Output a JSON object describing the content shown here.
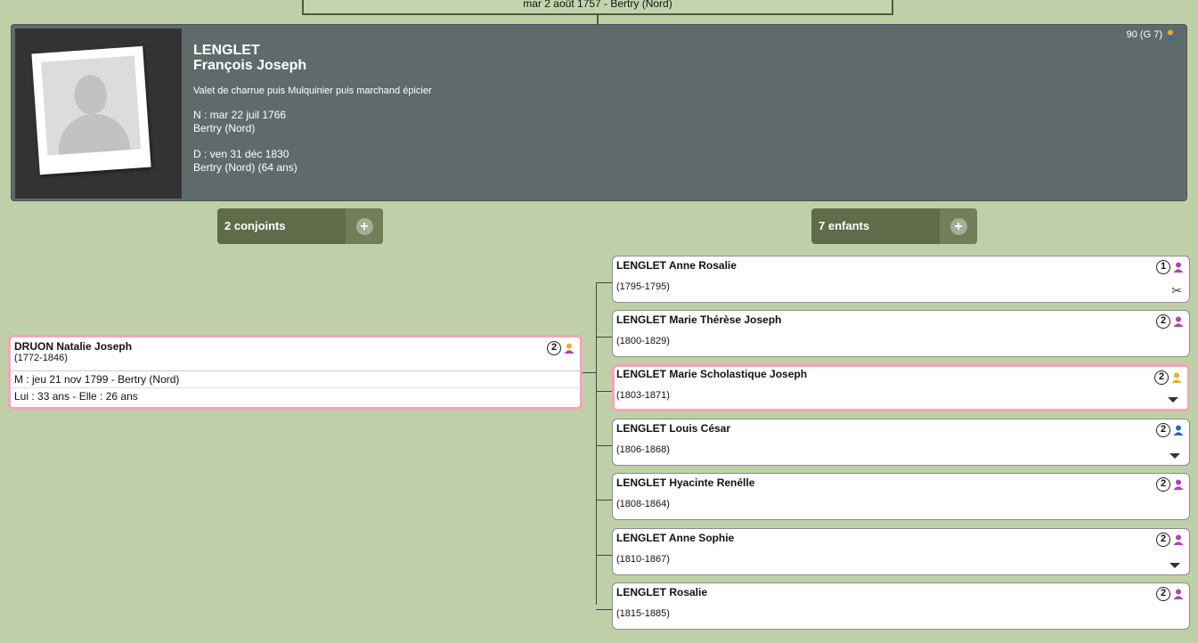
{
  "parent_marriage": "mar 2 août 1757 - Bertry (Nord)",
  "person": {
    "surname": "LENGLET",
    "given": "François Joseph",
    "occupation": "Valet de charrue puis Mulquinier puis marchand épicier",
    "birth_date": "N : mar 22 juil 1766",
    "birth_place": "Bertry (Nord)",
    "death_date": "D : ven 31 déc 1830",
    "death_place": "Bertry (Nord) (64 ans)",
    "sosa": "90 (G 7)"
  },
  "spouses_count": "2 conjoints",
  "children_count": "7 enfants",
  "spouse": {
    "name": "DRUON Natalie Joseph",
    "dates": "(1772-1846)",
    "marriage": "M : jeu 21 nov 1799 - Bertry (Nord)",
    "ages": "Lui : 33 ans - Elle : 26 ans",
    "num": "2"
  },
  "children": [
    {
      "name": "LENGLET Anne Rosalie",
      "dates": "(1795-1795)",
      "num": "1",
      "sex": "female"
    },
    {
      "name": "LENGLET Marie Thérèse Joseph",
      "dates": "(1800-1829)",
      "num": "2",
      "sex": "female"
    },
    {
      "name": "LENGLET Marie Scholastique Joseph",
      "dates": "(1803-1871)",
      "num": "2",
      "sex": "direct"
    },
    {
      "name": "LENGLET Louis César",
      "dates": "(1806-1868)",
      "num": "2",
      "sex": "male"
    },
    {
      "name": "LENGLET Hyacinte Renélle",
      "dates": "(1808-1864)",
      "num": "2",
      "sex": "female"
    },
    {
      "name": "LENGLET Anne Sophie",
      "dates": "(1810-1867)",
      "num": "2",
      "sex": "female"
    },
    {
      "name": "LENGLET Rosalie",
      "dates": "(1815-1885)",
      "num": "2",
      "sex": "female"
    }
  ],
  "colors": {
    "female": "#b040b8",
    "male": "#2a68c8",
    "direct": "#e8b020",
    "sosa_icon": "#e8b020"
  }
}
